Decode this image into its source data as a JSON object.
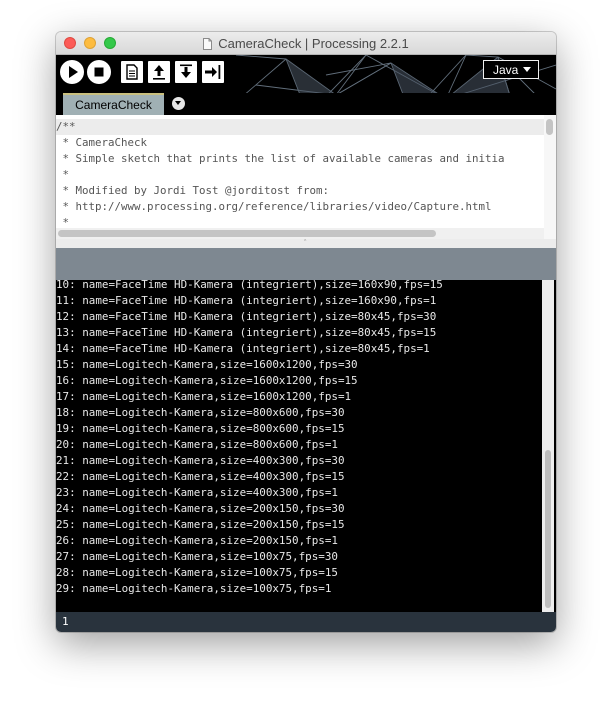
{
  "window": {
    "title": "CameraCheck | Processing 2.2.1"
  },
  "toolbar": {
    "buttons": [
      "play-icon",
      "stop-icon",
      "new-file-icon",
      "open-icon",
      "save-icon",
      "export-icon"
    ],
    "mode": "Java"
  },
  "tabs": {
    "active": "CameraCheck"
  },
  "editor": {
    "lines": [
      "/**",
      " * CameraCheck",
      " * Simple sketch that prints the list of available cameras and initia",
      " *",
      " * Modified by Jordi Tost @jorditost from:",
      " * http://www.processing.org/reference/libraries/video/Capture.html",
      " *"
    ]
  },
  "console": {
    "lines": [
      "10: name=FaceTime HD-Kamera (integriert),size=160x90,fps=15",
      "11: name=FaceTime HD-Kamera (integriert),size=160x90,fps=1",
      "12: name=FaceTime HD-Kamera (integriert),size=80x45,fps=30",
      "13: name=FaceTime HD-Kamera (integriert),size=80x45,fps=15",
      "14: name=FaceTime HD-Kamera (integriert),size=80x45,fps=1",
      "15: name=Logitech-Kamera,size=1600x1200,fps=30",
      "16: name=Logitech-Kamera,size=1600x1200,fps=15",
      "17: name=Logitech-Kamera,size=1600x1200,fps=1",
      "18: name=Logitech-Kamera,size=800x600,fps=30",
      "19: name=Logitech-Kamera,size=800x600,fps=15",
      "20: name=Logitech-Kamera,size=800x600,fps=1",
      "21: name=Logitech-Kamera,size=400x300,fps=30",
      "22: name=Logitech-Kamera,size=400x300,fps=15",
      "23: name=Logitech-Kamera,size=400x300,fps=1",
      "24: name=Logitech-Kamera,size=200x150,fps=30",
      "25: name=Logitech-Kamera,size=200x150,fps=15",
      "26: name=Logitech-Kamera,size=200x150,fps=1",
      "27: name=Logitech-Kamera,size=100x75,fps=30",
      "28: name=Logitech-Kamera,size=100x75,fps=15",
      "29: name=Logitech-Kamera,size=100x75,fps=1"
    ]
  },
  "status": {
    "line": "1"
  },
  "colors": {
    "close": "#fc5b57",
    "minimize": "#fdbc40",
    "zoom": "#34c84a",
    "tab": "#a0b0b4",
    "message_area": "#7e8891",
    "status_bar": "#29333d"
  }
}
